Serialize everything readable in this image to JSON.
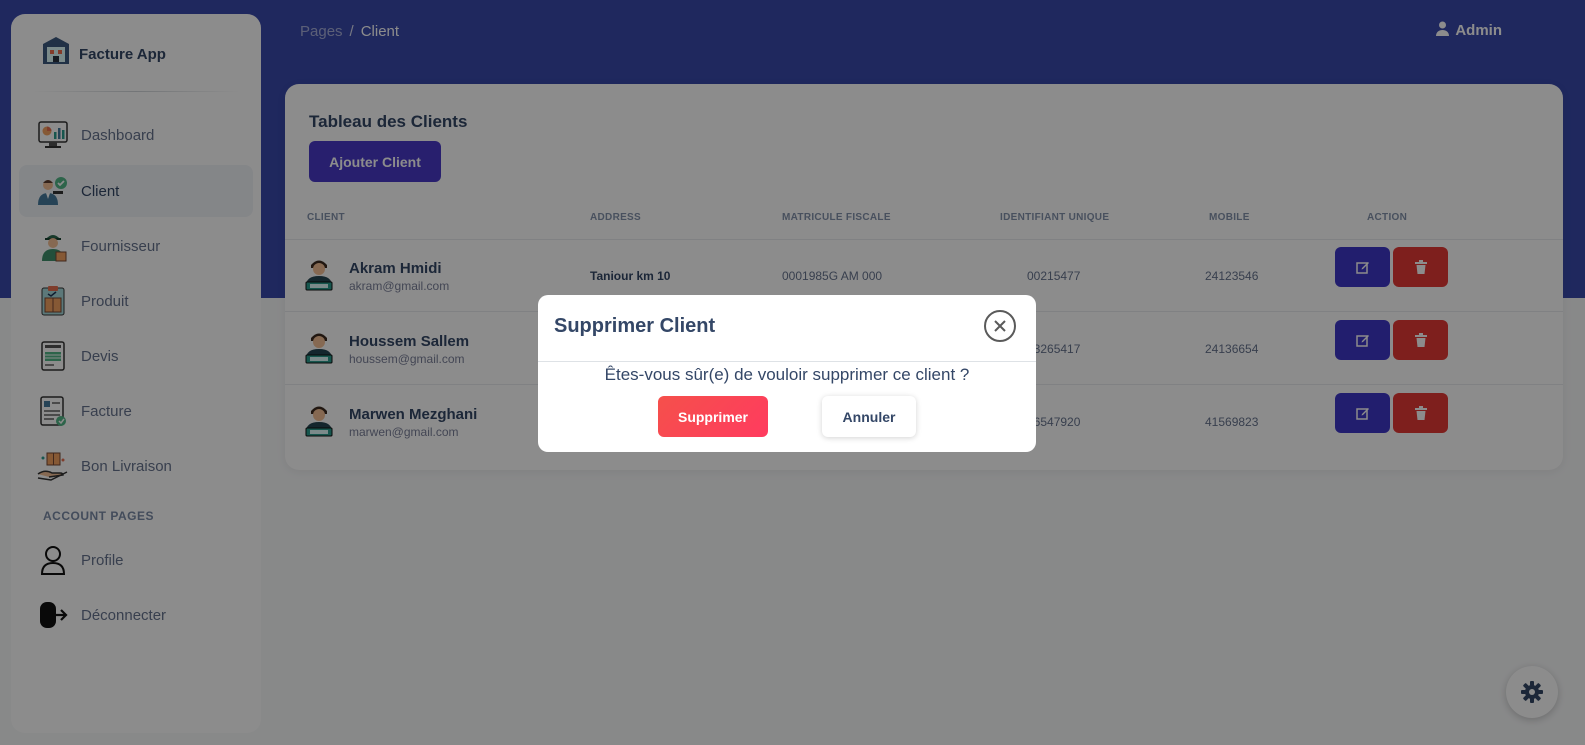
{
  "app": {
    "name": "Facture App"
  },
  "breadcrumb": {
    "parent": "Pages",
    "separator": "/",
    "current": "Client"
  },
  "user": {
    "name": "Admin"
  },
  "sidebar": {
    "items": [
      {
        "label": "Dashboard",
        "icon": "dashboard-icon"
      },
      {
        "label": "Client",
        "icon": "client-icon"
      },
      {
        "label": "Fournisseur",
        "icon": "supplier-icon"
      },
      {
        "label": "Produit",
        "icon": "product-icon"
      },
      {
        "label": "Devis",
        "icon": "quote-icon"
      },
      {
        "label": "Facture",
        "icon": "invoice-icon"
      },
      {
        "label": "Bon Livraison",
        "icon": "delivery-icon"
      }
    ],
    "section_title": "ACCOUNT PAGES",
    "account_items": [
      {
        "label": "Profile",
        "icon": "user-icon"
      },
      {
        "label": "Déconnecter",
        "icon": "logout-icon"
      }
    ]
  },
  "table": {
    "title": "Tableau des Clients",
    "add_label": "Ajouter Client",
    "headers": [
      "CLIENT",
      "ADDRESS",
      "MATRICULE FISCALE",
      "IDENTIFIANT UNIQUE",
      "MOBILE",
      "ACTION"
    ],
    "rows": [
      {
        "name": "Akram Hmidi",
        "email": "akram@gmail.com",
        "address": "Taniour km 10",
        "matricule": "0001985G AM 000",
        "identifiant": "00215477",
        "mobile": "24123546"
      },
      {
        "name": "Houssem Sallem",
        "email": "houssem@gmail.com",
        "address": "",
        "matricule": "",
        "identifiant": "03265417",
        "mobile": "24136654"
      },
      {
        "name": "Marwen Mezghani",
        "email": "marwen@gmail.com",
        "address": "",
        "matricule": "",
        "identifiant": "16547920",
        "mobile": "41569823"
      }
    ]
  },
  "modal": {
    "title": "Supprimer Client",
    "message": "Êtes-vous sûr(e) de vouloir supprimer ce client ?",
    "confirm_label": "Supprimer",
    "cancel_label": "Annuler"
  },
  "colors": {
    "header_bg": "#3949ab",
    "primary": "#4a3ac9",
    "danger": "#e53935"
  }
}
